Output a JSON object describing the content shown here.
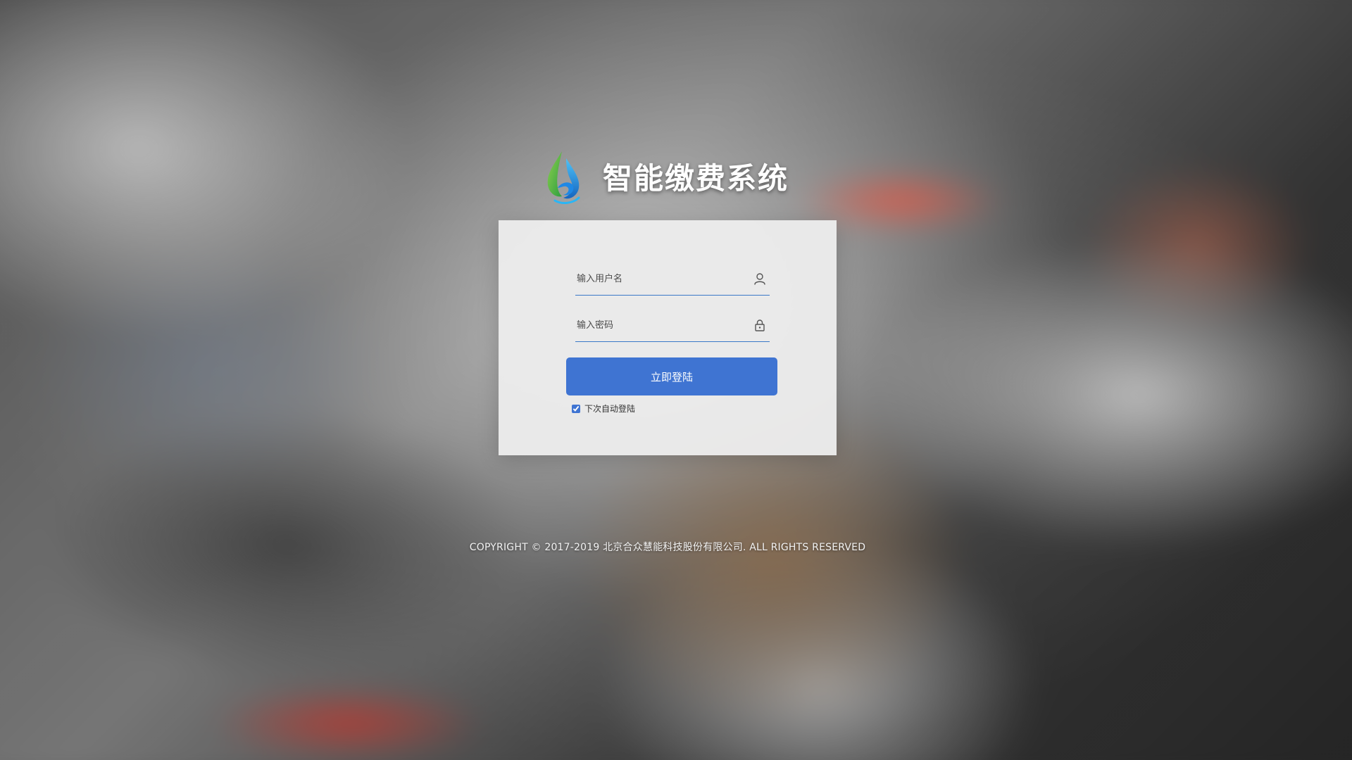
{
  "app": {
    "title": "智能缴费系统",
    "logo_icon": "water-drop-logo"
  },
  "login": {
    "username_placeholder": "输入用户名",
    "password_placeholder": "输入密码",
    "submit_label": "立即登陆",
    "remember_label": "下次自动登陆",
    "remember_checked": true
  },
  "icons": {
    "username": "user-icon",
    "password": "lock-icon"
  },
  "colors": {
    "accent": "#3f74d2",
    "field_underline": "#3a78c8",
    "card_bg": "#ececec",
    "title_text": "#ffffff"
  },
  "footer": {
    "copyright": "COPYRIGHT © 2017-2019 北京合众慧能科技股份有限公司. ALL RIGHTS RESERVED"
  }
}
